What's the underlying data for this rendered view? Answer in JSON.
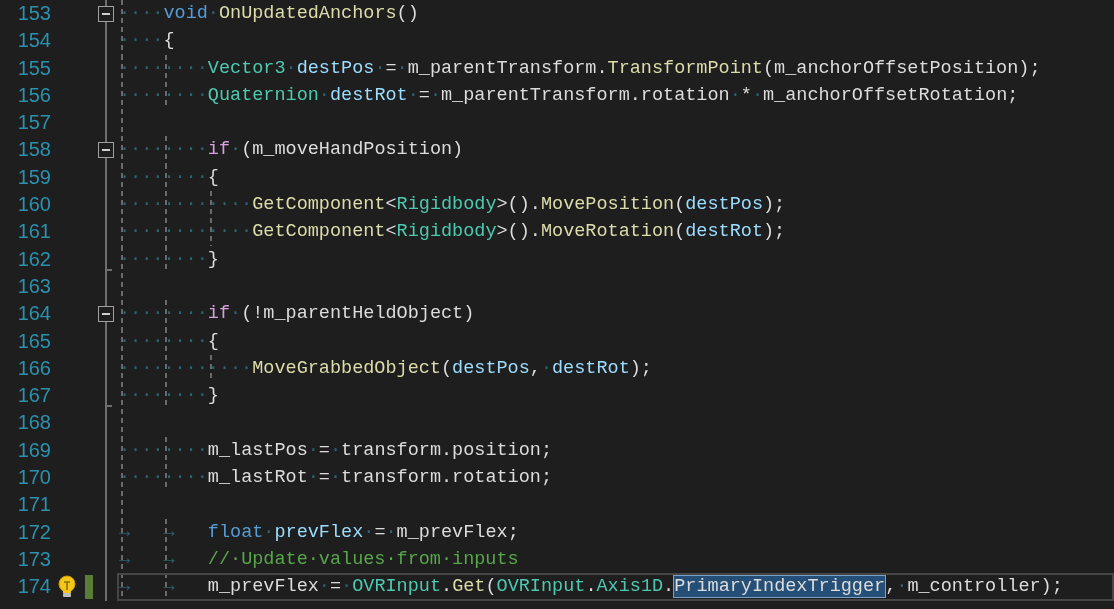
{
  "editor": {
    "lines": [
      {
        "number": "153",
        "foldable": true,
        "fold_end": false,
        "current": false,
        "tokens": [
          {
            "kind": "ws",
            "text": "····"
          },
          {
            "kind": "keyword",
            "text": "void"
          },
          {
            "kind": "ws",
            "text": "·"
          },
          {
            "kind": "method",
            "text": "OnUpdatedAnchors"
          },
          {
            "kind": "plain",
            "text": "()"
          }
        ]
      },
      {
        "number": "154",
        "foldable": false,
        "fold_end": false,
        "current": false,
        "tokens": [
          {
            "kind": "ws",
            "text": "····"
          },
          {
            "kind": "plain",
            "text": "{"
          }
        ]
      },
      {
        "number": "155",
        "foldable": false,
        "fold_end": false,
        "current": false,
        "tokens": [
          {
            "kind": "ws",
            "text": "········"
          },
          {
            "kind": "type",
            "text": "Vector3"
          },
          {
            "kind": "ws",
            "text": "·"
          },
          {
            "kind": "local",
            "text": "destPos"
          },
          {
            "kind": "ws",
            "text": "·"
          },
          {
            "kind": "plain",
            "text": "="
          },
          {
            "kind": "ws",
            "text": "·"
          },
          {
            "kind": "plain",
            "text": "m_parentTransform."
          },
          {
            "kind": "method",
            "text": "TransformPoint"
          },
          {
            "kind": "plain",
            "text": "(m_anchorOffsetPosition);"
          }
        ]
      },
      {
        "number": "156",
        "foldable": false,
        "fold_end": false,
        "current": false,
        "tokens": [
          {
            "kind": "ws",
            "text": "········"
          },
          {
            "kind": "type",
            "text": "Quaternion"
          },
          {
            "kind": "ws",
            "text": "·"
          },
          {
            "kind": "local",
            "text": "destRot"
          },
          {
            "kind": "ws",
            "text": "·"
          },
          {
            "kind": "plain",
            "text": "="
          },
          {
            "kind": "ws",
            "text": "·"
          },
          {
            "kind": "plain",
            "text": "m_parentTransform.rotation"
          },
          {
            "kind": "ws",
            "text": "·"
          },
          {
            "kind": "plain",
            "text": "*"
          },
          {
            "kind": "ws",
            "text": "·"
          },
          {
            "kind": "plain",
            "text": "m_anchorOffsetRotation;"
          }
        ]
      },
      {
        "number": "157",
        "foldable": false,
        "fold_end": false,
        "current": false
      },
      {
        "number": "158",
        "foldable": true,
        "fold_end": false,
        "current": false,
        "tokens": [
          {
            "kind": "ws",
            "text": "········"
          },
          {
            "kind": "control",
            "text": "if"
          },
          {
            "kind": "ws",
            "text": "·"
          },
          {
            "kind": "plain",
            "text": "(m_moveHandPosition)"
          }
        ]
      },
      {
        "number": "159",
        "foldable": false,
        "fold_end": false,
        "current": false,
        "tokens": [
          {
            "kind": "ws",
            "text": "········"
          },
          {
            "kind": "plain",
            "text": "{"
          }
        ]
      },
      {
        "number": "160",
        "foldable": false,
        "fold_end": false,
        "current": false,
        "tokens": [
          {
            "kind": "ws",
            "text": "············"
          },
          {
            "kind": "method",
            "text": "GetComponent"
          },
          {
            "kind": "plain",
            "text": "<"
          },
          {
            "kind": "type",
            "text": "Rigidbody"
          },
          {
            "kind": "plain",
            "text": ">()."
          },
          {
            "kind": "method",
            "text": "MovePosition"
          },
          {
            "kind": "plain",
            "text": "("
          },
          {
            "kind": "local",
            "text": "destPos"
          },
          {
            "kind": "plain",
            "text": ");"
          }
        ]
      },
      {
        "number": "161",
        "foldable": false,
        "fold_end": false,
        "current": false,
        "tokens": [
          {
            "kind": "ws",
            "text": "············"
          },
          {
            "kind": "method",
            "text": "GetComponent"
          },
          {
            "kind": "plain",
            "text": "<"
          },
          {
            "kind": "type",
            "text": "Rigidbody"
          },
          {
            "kind": "plain",
            "text": ">()."
          },
          {
            "kind": "method",
            "text": "MoveRotation"
          },
          {
            "kind": "plain",
            "text": "("
          },
          {
            "kind": "local",
            "text": "destRot"
          },
          {
            "kind": "plain",
            "text": ");"
          }
        ]
      },
      {
        "number": "162",
        "foldable": false,
        "fold_end": true,
        "current": false,
        "tokens": [
          {
            "kind": "ws",
            "text": "········"
          },
          {
            "kind": "plain",
            "text": "}"
          }
        ]
      },
      {
        "number": "163",
        "foldable": false,
        "fold_end": false,
        "current": false
      },
      {
        "number": "164",
        "foldable": true,
        "fold_end": false,
        "current": false,
        "tokens": [
          {
            "kind": "ws",
            "text": "········"
          },
          {
            "kind": "control",
            "text": "if"
          },
          {
            "kind": "ws",
            "text": "·"
          },
          {
            "kind": "plain",
            "text": "(!m_parentHeldObject)"
          }
        ]
      },
      {
        "number": "165",
        "foldable": false,
        "fold_end": false,
        "current": false,
        "tokens": [
          {
            "kind": "ws",
            "text": "········"
          },
          {
            "kind": "plain",
            "text": "{"
          }
        ]
      },
      {
        "number": "166",
        "foldable": false,
        "fold_end": false,
        "current": false,
        "tokens": [
          {
            "kind": "ws",
            "text": "············"
          },
          {
            "kind": "method",
            "text": "MoveGrabbedObject"
          },
          {
            "kind": "plain",
            "text": "("
          },
          {
            "kind": "local",
            "text": "destPos"
          },
          {
            "kind": "plain",
            "text": ","
          },
          {
            "kind": "ws",
            "text": "·"
          },
          {
            "kind": "local",
            "text": "destRot"
          },
          {
            "kind": "plain",
            "text": ");"
          }
        ]
      },
      {
        "number": "167",
        "foldable": false,
        "fold_end": true,
        "current": false,
        "tokens": [
          {
            "kind": "ws",
            "text": "········"
          },
          {
            "kind": "plain",
            "text": "}"
          }
        ]
      },
      {
        "number": "168",
        "foldable": false,
        "fold_end": false,
        "current": false
      },
      {
        "number": "169",
        "foldable": false,
        "fold_end": false,
        "current": false,
        "tokens": [
          {
            "kind": "ws",
            "text": "········"
          },
          {
            "kind": "plain",
            "text": "m_lastPos"
          },
          {
            "kind": "ws",
            "text": "·"
          },
          {
            "kind": "plain",
            "text": "="
          },
          {
            "kind": "ws",
            "text": "·"
          },
          {
            "kind": "plain",
            "text": "transform.position;"
          }
        ]
      },
      {
        "number": "170",
        "foldable": false,
        "fold_end": false,
        "current": false,
        "tokens": [
          {
            "kind": "ws",
            "text": "········"
          },
          {
            "kind": "plain",
            "text": "m_lastRot"
          },
          {
            "kind": "ws",
            "text": "·"
          },
          {
            "kind": "plain",
            "text": "="
          },
          {
            "kind": "ws",
            "text": "·"
          },
          {
            "kind": "plain",
            "text": "transform.rotation;"
          }
        ]
      },
      {
        "number": "171",
        "foldable": false,
        "fold_end": false,
        "current": false
      },
      {
        "number": "172",
        "foldable": false,
        "fold_end": false,
        "current": false,
        "tokens": [
          {
            "kind": "ws",
            "text": "→   →   "
          },
          {
            "kind": "keyword",
            "text": "float"
          },
          {
            "kind": "ws",
            "text": "·"
          },
          {
            "kind": "local",
            "text": "prevFlex"
          },
          {
            "kind": "ws",
            "text": "·"
          },
          {
            "kind": "plain",
            "text": "="
          },
          {
            "kind": "ws",
            "text": "·"
          },
          {
            "kind": "plain",
            "text": "m_prevFlex;"
          }
        ]
      },
      {
        "number": "173",
        "foldable": false,
        "fold_end": false,
        "current": false,
        "tokens": [
          {
            "kind": "ws",
            "text": "→   →   "
          },
          {
            "kind": "comment",
            "text": "//·Update·values·from·inputs"
          }
        ]
      },
      {
        "number": "174",
        "foldable": false,
        "fold_end": false,
        "current": true,
        "lightbulb": true,
        "changed": true,
        "tokens": [
          {
            "kind": "ws",
            "text": "→   →   "
          },
          {
            "kind": "plain",
            "text": "m_prevFlex"
          },
          {
            "kind": "ws",
            "text": "·"
          },
          {
            "kind": "plain",
            "text": "="
          },
          {
            "kind": "ws",
            "text": "·"
          },
          {
            "kind": "type",
            "text": "OVRInput"
          },
          {
            "kind": "plain",
            "text": "."
          },
          {
            "kind": "method",
            "text": "Get"
          },
          {
            "kind": "plain",
            "text": "("
          },
          {
            "kind": "type",
            "text": "OVRInput"
          },
          {
            "kind": "plain",
            "text": "."
          },
          {
            "kind": "type",
            "text": "Axis1D"
          },
          {
            "kind": "plain",
            "text": "."
          },
          {
            "kind": "selection",
            "text": "PrimaryIndexTrigger"
          },
          {
            "kind": "plain",
            "text": ","
          },
          {
            "kind": "ws",
            "text": "·"
          },
          {
            "kind": "plain",
            "text": "m_controller);"
          }
        ]
      }
    ]
  }
}
